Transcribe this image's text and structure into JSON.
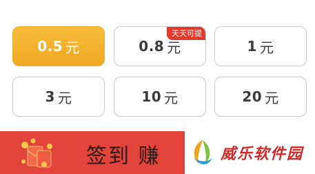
{
  "amounts": [
    {
      "value": "0.5",
      "unit": "元",
      "selected": true
    },
    {
      "value": "0.8",
      "unit": "元",
      "badge": "天天可提"
    },
    {
      "value": "1",
      "unit": "元"
    },
    {
      "value": "3",
      "unit": "元"
    },
    {
      "value": "10",
      "unit": "元"
    },
    {
      "value": "20",
      "unit": "元"
    }
  ],
  "banner": {
    "text": "签到 赚",
    "icon": "red-envelope-coins-icon"
  },
  "watermark": {
    "text": "威乐软件园",
    "icon": "leaf-logo-icon"
  },
  "colors": {
    "selected": "#f0ab28",
    "badge": "#e23b2b",
    "banner": "#e2433a",
    "border": "#c9c9c9"
  }
}
